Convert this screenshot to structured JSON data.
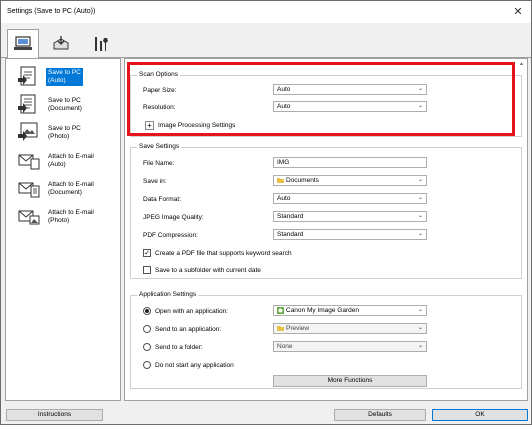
{
  "window": {
    "title": "Settings (Save to PC (Auto))",
    "close_glyph": "✕"
  },
  "tabs": [
    {
      "icon": "scan-from-computer-icon"
    },
    {
      "icon": "scan-from-panel-icon"
    },
    {
      "icon": "general-settings-icon"
    }
  ],
  "sidebar": {
    "items": [
      {
        "label": "Save to PC\n(Auto)",
        "icon": "save-auto-icon"
      },
      {
        "label": "Save to PC\n(Document)",
        "icon": "save-document-icon"
      },
      {
        "label": "Save to PC\n(Photo)",
        "icon": "save-photo-icon"
      },
      {
        "label": "Attach to E-mail\n(Auto)",
        "icon": "email-auto-icon"
      },
      {
        "label": "Attach to E-mail\n(Document)",
        "icon": "email-document-icon"
      },
      {
        "label": "Attach to E-mail\n(Photo)",
        "icon": "email-photo-icon"
      }
    ]
  },
  "scan_options": {
    "title": "Scan Options",
    "paper_size_label": "Paper Size:",
    "paper_size_value": "Auto",
    "resolution_label": "Resolution:",
    "resolution_value": "Auto",
    "expand_glyph": "+",
    "image_processing_label": "Image Processing Settings"
  },
  "save_settings": {
    "title": "Save Settings",
    "file_name_label": "File Name:",
    "file_name_value": "IMG",
    "save_in_label": "Save in:",
    "save_in_value": "Documents",
    "data_format_label": "Data Format:",
    "data_format_value": "Auto",
    "jpeg_quality_label": "JPEG Image Quality:",
    "jpeg_quality_value": "Standard",
    "pdf_compression_label": "PDF Compression:",
    "pdf_compression_value": "Standard",
    "keyword_pdf_label": "Create a PDF file that supports keyword search",
    "keyword_pdf_checked": true,
    "subfolder_label": "Save to a subfolder with current date",
    "subfolder_checked": false
  },
  "app_settings": {
    "title": "Application Settings",
    "open_app_label": "Open with an application:",
    "open_app_value": "Canon My Image Garden",
    "send_app_label": "Send to an application:",
    "send_app_value": "Preview",
    "send_folder_label": "Send to a folder:",
    "send_folder_value": "None",
    "no_app_label": "Do not start any application",
    "more_functions_label": "More Functions",
    "selected_option": "open_app"
  },
  "footer": {
    "instructions_label": "Instructions",
    "defaults_label": "Defaults",
    "ok_label": "OK"
  },
  "colors": {
    "highlight": "#e8121b",
    "selection": "#0078d7"
  }
}
